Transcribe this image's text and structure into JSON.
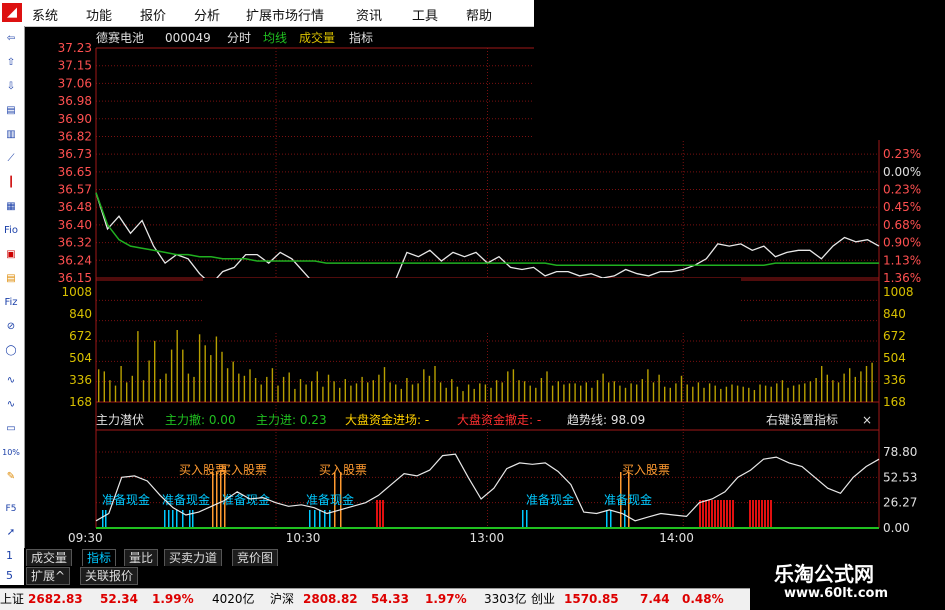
{
  "menu": [
    "系统",
    "功能",
    "报价",
    "分析",
    "扩展市场行情",
    "资讯",
    "工具",
    "帮助"
  ],
  "toolbar_icons": [
    "back-arrow-icon",
    "up-arrow-icon",
    "down-arrow-icon",
    "quote-icon",
    "list-icon",
    "line-chart-icon",
    "candle-icon",
    "f10-icon",
    "fio-icon",
    "f5-icon",
    "f1-icon",
    "fiz-icon",
    "zoom-icon",
    "circle-icon",
    "wave-icon",
    "wave2-icon",
    "stat-icon",
    "percent-icon",
    "pencil-icon",
    "f5b-icon",
    "cursor-icon"
  ],
  "toolbar_labels": {
    "fio": "Fio",
    "fiz": "Fiz",
    "pct": "%",
    "pct_full": "10%",
    "f5": "F5"
  },
  "header": {
    "stock_name": "德赛电池",
    "stock_code": "000049",
    "mode": "分时",
    "avg_label": "均线",
    "vol_label": "成交量",
    "indicator_label": "指标"
  },
  "indicator_header": {
    "name": "主力潜伏",
    "main_withdraw": "主力撤: 0.00",
    "main_enter": "主力进: 0.23",
    "market_in": "大盘资金进场: -",
    "market_out": "大盘资金撤走: -",
    "trend": "趋势线: 98.09",
    "settings": "右键设置指标",
    "close": "×"
  },
  "annotations": {
    "buy": "买入股票",
    "prepare": "准备现金"
  },
  "bottom_tabs_1": [
    "成交量",
    "指标",
    "量比",
    "买卖力道",
    "竞价图"
  ],
  "bottom_tabs_2": [
    "扩展^",
    "关联报价"
  ],
  "side_numbers": [
    "1",
    "5"
  ],
  "status": [
    {
      "label": "上证",
      "value": "2682.83",
      "change": "52.34",
      "pct": "1.99%",
      "amount": "4020亿"
    },
    {
      "label": "沪深",
      "value": "2808.82",
      "change": "54.33",
      "pct": "1.97%",
      "amount": "3303亿"
    },
    {
      "label": "创业",
      "value": "1570.85",
      "change": "7.44",
      "pct": "0.48%",
      "amount": ""
    }
  ],
  "watermark": {
    "title": "乐淘公式网",
    "url": "www.60lt.com"
  },
  "colors": {
    "up": "#ff3b3b",
    "green": "#00c000",
    "price_line": "#e8e8e8",
    "avg_line": "#20b020",
    "volume": "#b8a000",
    "indicator": "#e8e8e8",
    "cyan": "#00c8ff",
    "orange": "#ff9a30",
    "red_bar": "#e01010",
    "axis_red": "#ff5050",
    "axis_yellow": "#d8c000",
    "grid": "#7a1010"
  },
  "chart_data": [
    {
      "type": "line",
      "name": "price",
      "x_ticks": [
        "09:30",
        "10:30",
        "13:00",
        "14:00"
      ],
      "y_ticks": [
        "37.23",
        "37.15",
        "37.06",
        "36.98",
        "36.90",
        "36.82",
        "36.73",
        "36.65",
        "36.57",
        "36.48",
        "36.40",
        "36.32",
        "36.24",
        "36.15"
      ],
      "pct_ticks": [
        "0.23%",
        "0.00%",
        "0.23%",
        "0.45%",
        "0.68%",
        "0.90%",
        "1.13%",
        "1.36%"
      ],
      "ylim": [
        36.15,
        37.23
      ],
      "series": [
        {
          "values": [
            36.55,
            36.38,
            36.44,
            36.36,
            36.42,
            36.3,
            36.22,
            36.26,
            36.24,
            36.17,
            36.12,
            36.18,
            36.2,
            36.26,
            36.26,
            36.22,
            36.27,
            36.24,
            36.18,
            36.12,
            36.1,
            36.14,
            36.12,
            36.11,
            36.13,
            36.12,
            36.14,
            36.27,
            36.25,
            36.28,
            36.23,
            36.27,
            36.25,
            36.27,
            36.22,
            36.25,
            36.2,
            36.19,
            36.2,
            36.16,
            36.18,
            36.18,
            36.16,
            36.17,
            36.15,
            36.16,
            36.19,
            36.17,
            36.16,
            36.18,
            36.18,
            36.19,
            36.21,
            36.24,
            36.31,
            36.3,
            36.31,
            36.28,
            36.3,
            36.25,
            36.27,
            36.28,
            36.28,
            36.24,
            36.3,
            36.34,
            36.32,
            36.33,
            36.3
          ]
        },
        {
          "values": [
            36.55,
            36.4,
            36.33,
            36.3,
            36.29,
            36.28,
            36.27,
            36.26,
            36.26,
            36.25,
            36.25,
            36.24,
            36.24,
            36.24,
            36.23,
            36.23,
            36.23,
            36.23,
            36.23,
            36.23,
            36.22,
            36.22,
            36.22,
            36.22,
            36.22,
            36.22,
            36.22,
            36.22,
            36.22,
            36.22,
            36.22,
            36.22,
            36.22,
            36.22,
            36.22,
            36.22,
            36.22,
            36.22,
            36.22,
            36.22,
            36.21,
            36.21,
            36.21,
            36.21,
            36.21,
            36.21,
            36.21,
            36.21,
            36.21,
            36.21,
            36.21,
            36.21,
            36.21,
            36.21,
            36.21,
            36.21,
            36.21,
            36.21,
            36.21,
            36.22,
            36.22,
            36.22,
            36.22,
            36.22,
            36.22,
            36.22,
            36.22,
            36.22,
            36.22
          ]
        }
      ]
    },
    {
      "type": "bar",
      "name": "volume",
      "y_ticks": [
        "1008",
        "840",
        "672",
        "504",
        "336",
        "168"
      ],
      "ylim": [
        0,
        1008
      ],
      "values": [
        300,
        280,
        200,
        150,
        330,
        180,
        240,
        650,
        200,
        380,
        560,
        210,
        260,
        480,
        660,
        480,
        260,
        230,
        620,
        520,
        430,
        600,
        460,
        310,
        370,
        260,
        240,
        300,
        220,
        160,
        230,
        310,
        150,
        230,
        270,
        120,
        210,
        160,
        190,
        280,
        140,
        250,
        190,
        130,
        210,
        150,
        170,
        230,
        180,
        200,
        250,
        320,
        180,
        160,
        120,
        220,
        160,
        170,
        300,
        240,
        330,
        180,
        130,
        210,
        140,
        100,
        160,
        120,
        170,
        160,
        130,
        200,
        180,
        280,
        300,
        200,
        190,
        150,
        130,
        220,
        280,
        150,
        190,
        160,
        170,
        170,
        150,
        180,
        130,
        200,
        260,
        180,
        190,
        150,
        130,
        170,
        160,
        210,
        300,
        180,
        250,
        140,
        130,
        170,
        240,
        160,
        140,
        180,
        130,
        170,
        150,
        120,
        140,
        160,
        150,
        140,
        130,
        110,
        160,
        150,
        140,
        170,
        200,
        130,
        150,
        160,
        170,
        190,
        220,
        330,
        250,
        200,
        180,
        260,
        310,
        230,
        280,
        330,
        360
      ]
    },
    {
      "type": "line",
      "name": "主力潜伏",
      "y_ticks": [
        "78.80",
        "52.53",
        "26.27",
        "0.00"
      ],
      "ylim": [
        0,
        105
      ],
      "series": [
        {
          "name": "趋势线",
          "values": [
            10,
            20,
            70,
            72,
            65,
            45,
            28,
            18,
            22,
            30,
            38,
            50,
            40,
            42,
            35,
            30,
            32,
            28,
            20,
            25,
            30,
            35,
            45,
            60,
            75,
            72,
            80,
            100,
            102,
            70,
            40,
            55,
            82,
            90,
            88,
            90,
            78,
            60,
            22,
            20,
            25,
            20,
            10,
            15,
            20,
            18,
            16,
            35,
            40,
            50,
            70,
            80,
            95,
            98,
            90,
            85,
            70,
            55,
            48,
            70,
            85,
            95
          ]
        }
      ]
    }
  ]
}
